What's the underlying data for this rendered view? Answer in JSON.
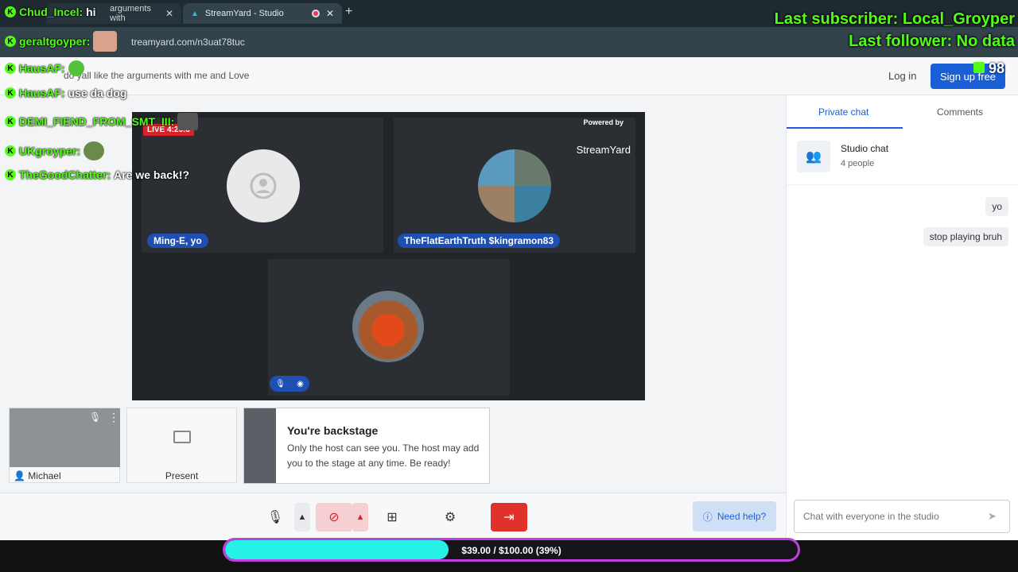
{
  "browser": {
    "tabs": [
      {
        "label": "arguments with"
      },
      {
        "label": "StreamYard - Studio"
      }
    ],
    "url": "treamyard.com/n3uat78tuc"
  },
  "header": {
    "room_title": "do yall like the arguments with me and Love",
    "login_label": "Log in",
    "signup_label": "Sign up free"
  },
  "stage": {
    "live_label": "LIVE 4:26:3",
    "powered_by": "Powered by",
    "brand": "StreamYard",
    "participants": [
      {
        "name": "Ming-E, yo"
      },
      {
        "name": "TheFlatEarthTruth $kingramon83"
      }
    ]
  },
  "bottom_cards": {
    "self_name": "Michael",
    "present_label": "Present",
    "backstage_title": "You're backstage",
    "backstage_text": "Only the host can see you. The host may add you to the stage at any time. Be ready!"
  },
  "toolbar": {
    "help_label": "Need help?"
  },
  "sidebar": {
    "tabs": [
      {
        "label": "Private chat",
        "active": true
      },
      {
        "label": "Comments",
        "active": false
      }
    ],
    "studio_chat_title": "Studio chat",
    "studio_chat_people": "4 people",
    "messages": [
      {
        "text": "yo"
      },
      {
        "text": "stop playing bruh"
      }
    ],
    "input_placeholder": "Chat with everyone in the studio"
  },
  "overlay": {
    "chat": [
      {
        "user": "Chud_Incel:",
        "msg": "hi"
      },
      {
        "user": "geraltgoyper:",
        "msg": ""
      },
      {
        "user": "HausAF:",
        "msg": ""
      },
      {
        "user": "HausAF:",
        "msg": "use da dog"
      },
      {
        "user": "DEMI_FIEND_FROM_SMT_III:",
        "msg": ""
      },
      {
        "user": "UKgroyper:",
        "msg": ""
      },
      {
        "user": "TheGoodChatter:",
        "msg": "Are we back!?"
      }
    ],
    "last_subscriber": "Last subscriber: Local_Groyper",
    "last_follower": "Last follower: No data",
    "viewer_count": "98",
    "goal_text": "$39.00 / $100.00 (39%)",
    "goal_progress": 0.39
  },
  "colors": {
    "accent": "#1a5fd6",
    "kick_green": "#53fc18",
    "goal_fill": "#25f1e7",
    "goal_border": "#c03fe0",
    "live_red": "#d8232a"
  }
}
